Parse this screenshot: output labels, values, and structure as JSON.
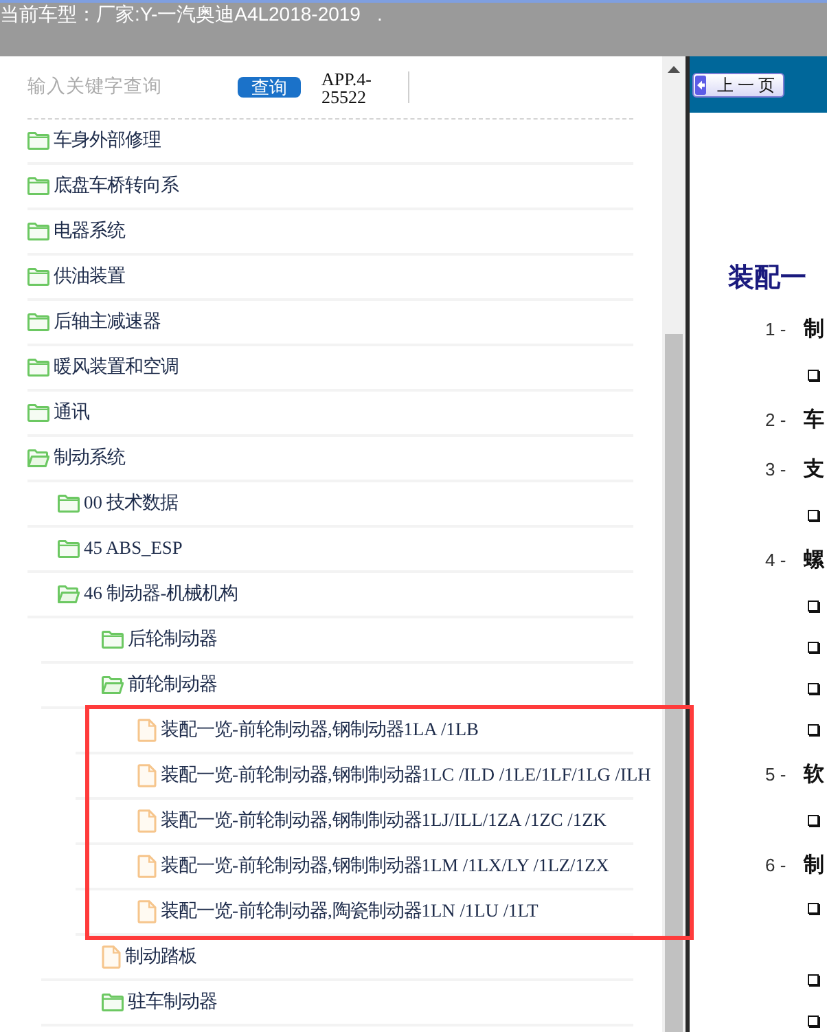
{
  "header": {
    "label": "当前车型：",
    "model": "厂家:Y-一汽奥迪A4L2018-2019",
    "suffix": "."
  },
  "search": {
    "placeholder": "输入关键字查询",
    "button": "查询",
    "app_code": "APP.4-25522"
  },
  "tree": [
    {
      "label": "车身外部修理",
      "kind": "folder",
      "expanded": false
    },
    {
      "label": "底盘车桥转向系",
      "kind": "folder",
      "expanded": false
    },
    {
      "label": "电器系统",
      "kind": "folder",
      "expanded": false
    },
    {
      "label": "供油装置",
      "kind": "folder",
      "expanded": false
    },
    {
      "label": "后轴主减速器",
      "kind": "folder",
      "expanded": false
    },
    {
      "label": "暖风装置和空调",
      "kind": "folder",
      "expanded": false
    },
    {
      "label": "通讯",
      "kind": "folder",
      "expanded": false
    },
    {
      "label": "制动系统",
      "kind": "folder",
      "expanded": true,
      "children": [
        {
          "label": "00 技术数据",
          "kind": "folder",
          "expanded": false
        },
        {
          "label": "45 ABS_ESP",
          "kind": "folder",
          "expanded": false
        },
        {
          "label": "46 制动器-机械机构",
          "kind": "folder",
          "expanded": true,
          "children": [
            {
              "label": "后轮制动器",
              "kind": "folder",
              "expanded": false
            },
            {
              "label": "前轮制动器",
              "kind": "folder",
              "expanded": true,
              "children_framed": true,
              "children": [
                {
                  "label": "装配一览-前轮制动器,钢制动器1LA /1LB",
                  "kind": "document"
                },
                {
                  "label": "装配一览-前轮制动器,钢制制动器1LC /ILD /1LE/1LF/1LG /ILH",
                  "kind": "document"
                },
                {
                  "label": "装配一览-前轮制动器,钢制制动器1LJ/ILL/1ZA /1ZC /1ZK",
                  "kind": "document"
                },
                {
                  "label": "装配一览-前轮制动器,钢制制动器1LM /1LX/LY /1LZ/1ZX",
                  "kind": "document"
                },
                {
                  "label": "装配一览-前轮制动器,陶瓷制动器1LN /1LU /1LT",
                  "kind": "document"
                }
              ]
            },
            {
              "label": "制动踏板",
              "kind": "document"
            },
            {
              "label": "驻车制动器",
              "kind": "folder",
              "expanded": false
            }
          ]
        }
      ]
    }
  ],
  "document_panel": {
    "back_button": "上一页",
    "heading": "装配一",
    "sections": [
      {
        "number": "1 -",
        "title": "制",
        "bullets": [
          {
            "kind": "square"
          }
        ]
      },
      {
        "number": "2 -",
        "title": "车"
      },
      {
        "number": "3 -",
        "title": "支",
        "bullets": [
          {
            "kind": "square"
          }
        ]
      },
      {
        "number": "4 -",
        "title": "螺",
        "bullets": [
          {
            "kind": "square"
          },
          {
            "kind": "square"
          },
          {
            "kind": "square"
          },
          {
            "kind": "square"
          }
        ]
      },
      {
        "number": "5 -",
        "title": "软",
        "bullets": [
          {
            "kind": "square"
          }
        ]
      },
      {
        "number": "6 -",
        "title": "制",
        "bullets": [
          {
            "kind": "square_two_line"
          },
          {
            "kind": "square"
          },
          {
            "kind": "square"
          }
        ]
      }
    ]
  }
}
